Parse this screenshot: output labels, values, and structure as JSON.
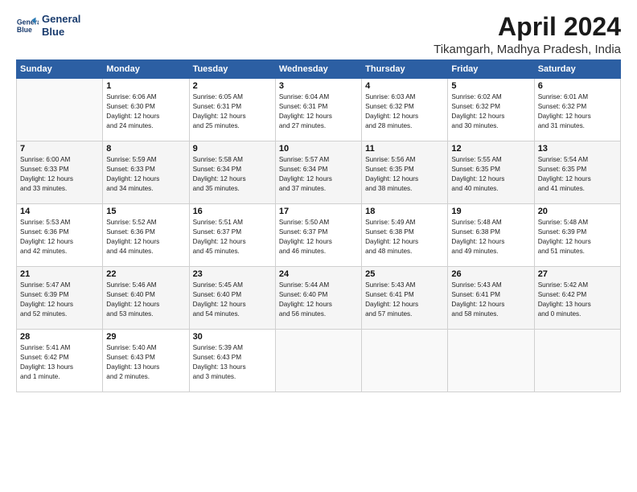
{
  "header": {
    "logo_line1": "General",
    "logo_line2": "Blue",
    "month": "April 2024",
    "location": "Tikamgarh, Madhya Pradesh, India"
  },
  "weekdays": [
    "Sunday",
    "Monday",
    "Tuesday",
    "Wednesday",
    "Thursday",
    "Friday",
    "Saturday"
  ],
  "weeks": [
    [
      {
        "day": "",
        "info": ""
      },
      {
        "day": "1",
        "info": "Sunrise: 6:06 AM\nSunset: 6:30 PM\nDaylight: 12 hours\nand 24 minutes."
      },
      {
        "day": "2",
        "info": "Sunrise: 6:05 AM\nSunset: 6:31 PM\nDaylight: 12 hours\nand 25 minutes."
      },
      {
        "day": "3",
        "info": "Sunrise: 6:04 AM\nSunset: 6:31 PM\nDaylight: 12 hours\nand 27 minutes."
      },
      {
        "day": "4",
        "info": "Sunrise: 6:03 AM\nSunset: 6:32 PM\nDaylight: 12 hours\nand 28 minutes."
      },
      {
        "day": "5",
        "info": "Sunrise: 6:02 AM\nSunset: 6:32 PM\nDaylight: 12 hours\nand 30 minutes."
      },
      {
        "day": "6",
        "info": "Sunrise: 6:01 AM\nSunset: 6:32 PM\nDaylight: 12 hours\nand 31 minutes."
      }
    ],
    [
      {
        "day": "7",
        "info": "Sunrise: 6:00 AM\nSunset: 6:33 PM\nDaylight: 12 hours\nand 33 minutes."
      },
      {
        "day": "8",
        "info": "Sunrise: 5:59 AM\nSunset: 6:33 PM\nDaylight: 12 hours\nand 34 minutes."
      },
      {
        "day": "9",
        "info": "Sunrise: 5:58 AM\nSunset: 6:34 PM\nDaylight: 12 hours\nand 35 minutes."
      },
      {
        "day": "10",
        "info": "Sunrise: 5:57 AM\nSunset: 6:34 PM\nDaylight: 12 hours\nand 37 minutes."
      },
      {
        "day": "11",
        "info": "Sunrise: 5:56 AM\nSunset: 6:35 PM\nDaylight: 12 hours\nand 38 minutes."
      },
      {
        "day": "12",
        "info": "Sunrise: 5:55 AM\nSunset: 6:35 PM\nDaylight: 12 hours\nand 40 minutes."
      },
      {
        "day": "13",
        "info": "Sunrise: 5:54 AM\nSunset: 6:35 PM\nDaylight: 12 hours\nand 41 minutes."
      }
    ],
    [
      {
        "day": "14",
        "info": "Sunrise: 5:53 AM\nSunset: 6:36 PM\nDaylight: 12 hours\nand 42 minutes."
      },
      {
        "day": "15",
        "info": "Sunrise: 5:52 AM\nSunset: 6:36 PM\nDaylight: 12 hours\nand 44 minutes."
      },
      {
        "day": "16",
        "info": "Sunrise: 5:51 AM\nSunset: 6:37 PM\nDaylight: 12 hours\nand 45 minutes."
      },
      {
        "day": "17",
        "info": "Sunrise: 5:50 AM\nSunset: 6:37 PM\nDaylight: 12 hours\nand 46 minutes."
      },
      {
        "day": "18",
        "info": "Sunrise: 5:49 AM\nSunset: 6:38 PM\nDaylight: 12 hours\nand 48 minutes."
      },
      {
        "day": "19",
        "info": "Sunrise: 5:48 AM\nSunset: 6:38 PM\nDaylight: 12 hours\nand 49 minutes."
      },
      {
        "day": "20",
        "info": "Sunrise: 5:48 AM\nSunset: 6:39 PM\nDaylight: 12 hours\nand 51 minutes."
      }
    ],
    [
      {
        "day": "21",
        "info": "Sunrise: 5:47 AM\nSunset: 6:39 PM\nDaylight: 12 hours\nand 52 minutes."
      },
      {
        "day": "22",
        "info": "Sunrise: 5:46 AM\nSunset: 6:40 PM\nDaylight: 12 hours\nand 53 minutes."
      },
      {
        "day": "23",
        "info": "Sunrise: 5:45 AM\nSunset: 6:40 PM\nDaylight: 12 hours\nand 54 minutes."
      },
      {
        "day": "24",
        "info": "Sunrise: 5:44 AM\nSunset: 6:40 PM\nDaylight: 12 hours\nand 56 minutes."
      },
      {
        "day": "25",
        "info": "Sunrise: 5:43 AM\nSunset: 6:41 PM\nDaylight: 12 hours\nand 57 minutes."
      },
      {
        "day": "26",
        "info": "Sunrise: 5:43 AM\nSunset: 6:41 PM\nDaylight: 12 hours\nand 58 minutes."
      },
      {
        "day": "27",
        "info": "Sunrise: 5:42 AM\nSunset: 6:42 PM\nDaylight: 13 hours\nand 0 minutes."
      }
    ],
    [
      {
        "day": "28",
        "info": "Sunrise: 5:41 AM\nSunset: 6:42 PM\nDaylight: 13 hours\nand 1 minute."
      },
      {
        "day": "29",
        "info": "Sunrise: 5:40 AM\nSunset: 6:43 PM\nDaylight: 13 hours\nand 2 minutes."
      },
      {
        "day": "30",
        "info": "Sunrise: 5:39 AM\nSunset: 6:43 PM\nDaylight: 13 hours\nand 3 minutes."
      },
      {
        "day": "",
        "info": ""
      },
      {
        "day": "",
        "info": ""
      },
      {
        "day": "",
        "info": ""
      },
      {
        "day": "",
        "info": ""
      }
    ]
  ]
}
